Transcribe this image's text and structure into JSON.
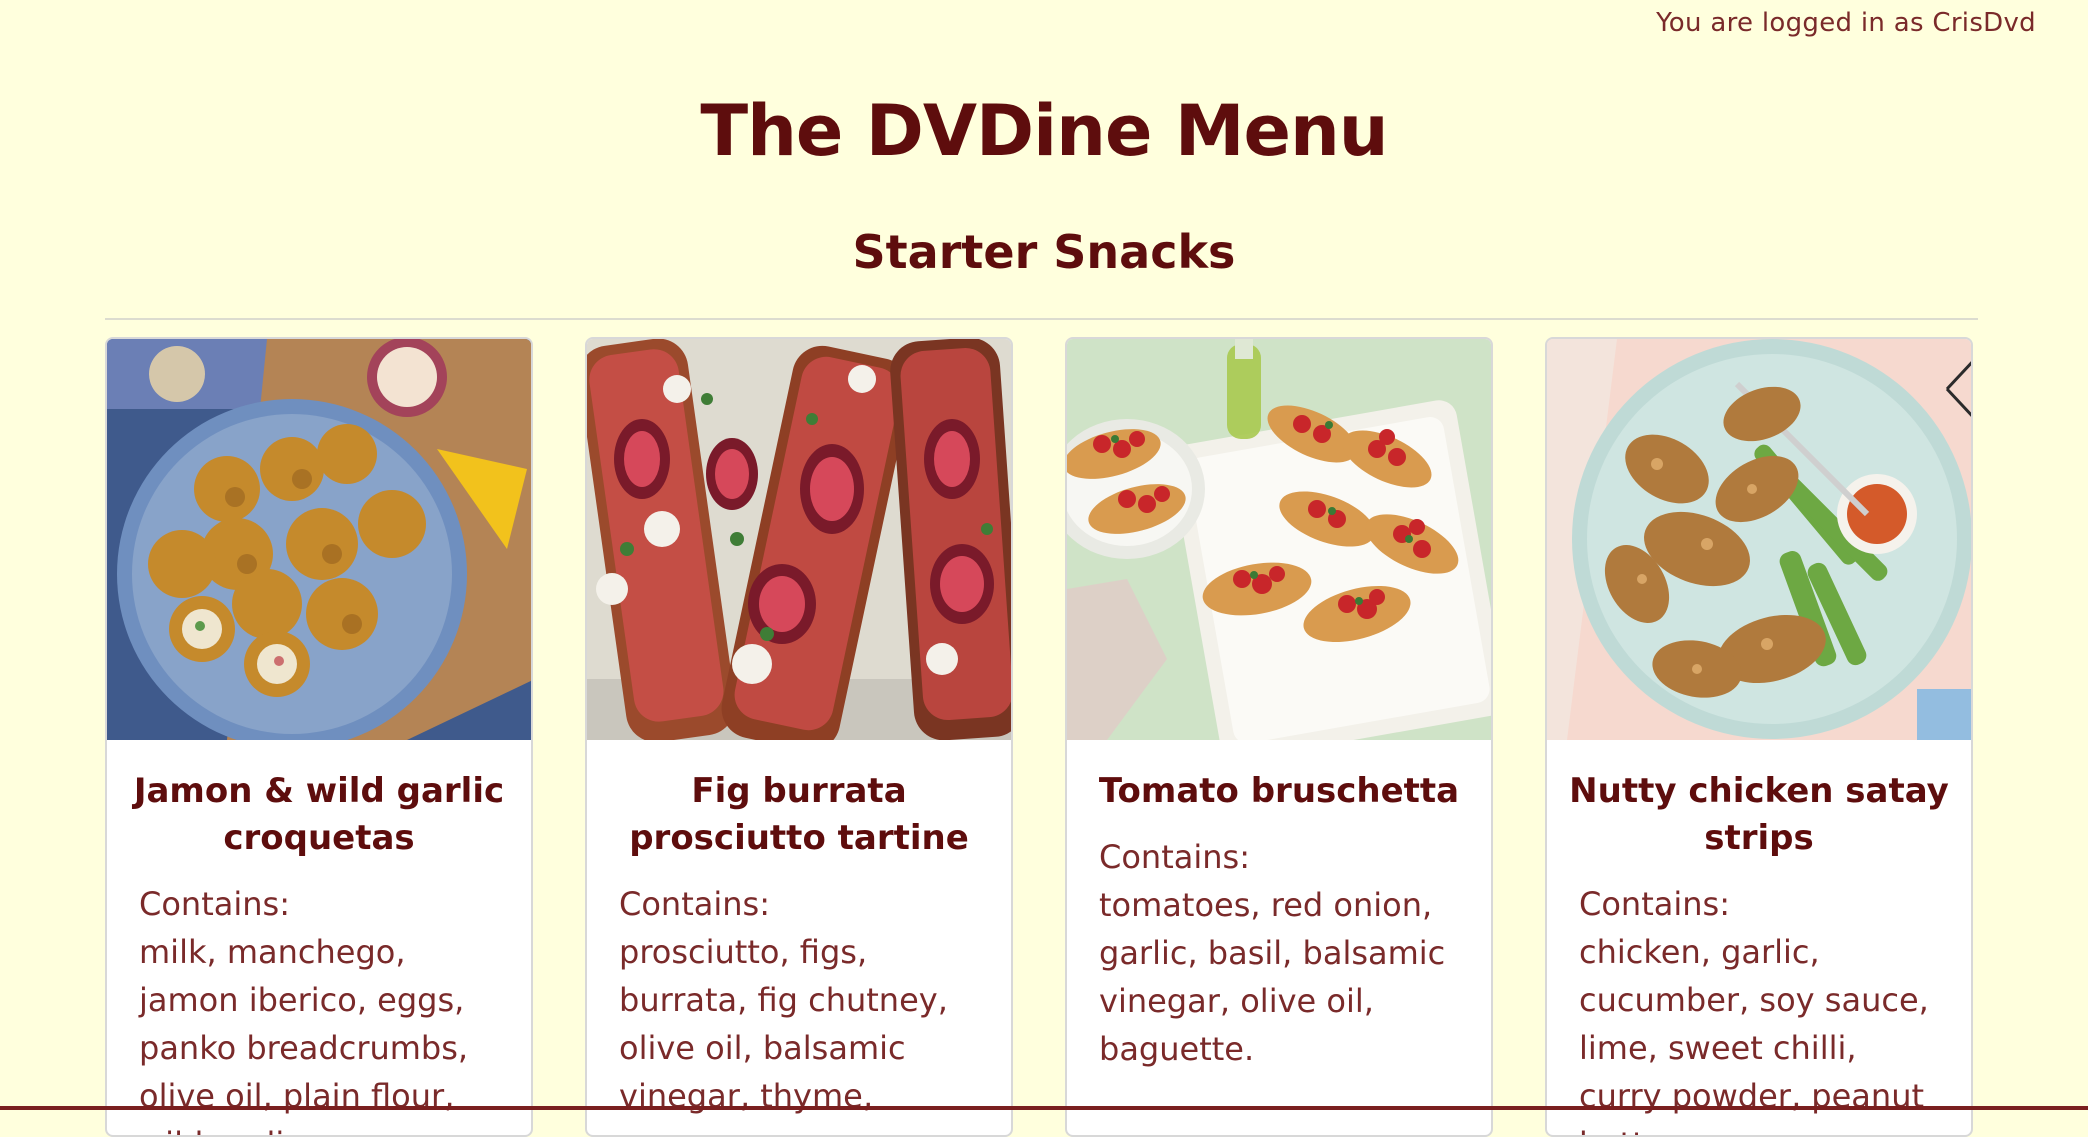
{
  "header": {
    "login_text": "You are logged in as CrisDvd"
  },
  "page": {
    "title": "The DVDine Menu",
    "section_title": "Starter Snacks"
  },
  "cards": [
    {
      "title": "Jamon & wild garlic croquetas",
      "contains_label": "Contains:",
      "ingredients": "milk, manchego, jamon iberico, eggs, panko breadcrumbs, olive oil, plain flour, wild garlic,",
      "image": "croquetas-photo"
    },
    {
      "title": "Fig burrata prosciutto tartine",
      "contains_label": "Contains:",
      "ingredients": "prosciutto, figs, burrata, fig chutney, olive oil, balsamic vinegar, thyme,",
      "image": "tartine-photo"
    },
    {
      "title": "Tomato bruschetta",
      "contains_label": "Contains:",
      "ingredients": "tomatoes, red onion, garlic, basil, balsamic vinegar, olive oil, baguette.",
      "image": "bruschetta-photo"
    },
    {
      "title": "Nutty chicken satay strips",
      "contains_label": "Contains:",
      "ingredients": "chicken, garlic, cucumber, soy sauce, lime, sweet chilli, curry powder, peanut butter,",
      "image": "satay-photo"
    }
  ],
  "colors": {
    "background": "#ffffdd",
    "heading": "#5e0d0d",
    "text": "#7a2a2a",
    "card": "#ffffff"
  }
}
